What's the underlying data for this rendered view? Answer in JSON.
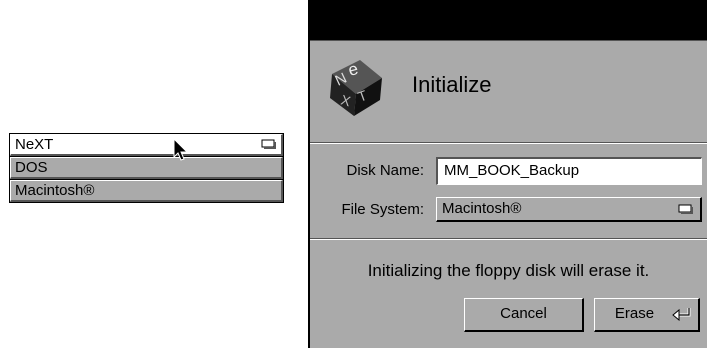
{
  "popup_list": {
    "items": [
      {
        "label": "NeXT",
        "selected": true
      },
      {
        "label": "DOS",
        "selected": false
      },
      {
        "label": "Macintosh®",
        "selected": false
      }
    ],
    "icon": "popup-indicator-icon"
  },
  "panel": {
    "title": "Initialize",
    "logo": "next-cube-logo",
    "disk_name_label": "Disk Name:",
    "disk_name_value": "MM_BOOK_Backup",
    "file_system_label": "File System:",
    "file_system_value": "Macintosh®",
    "message": "Initializing the floppy disk will erase it.",
    "cancel_label": "Cancel",
    "erase_label": "Erase"
  },
  "colors": {
    "panel_gray": "#aaaaaa",
    "dark_gray": "#555555",
    "titlebar": "#000000"
  }
}
